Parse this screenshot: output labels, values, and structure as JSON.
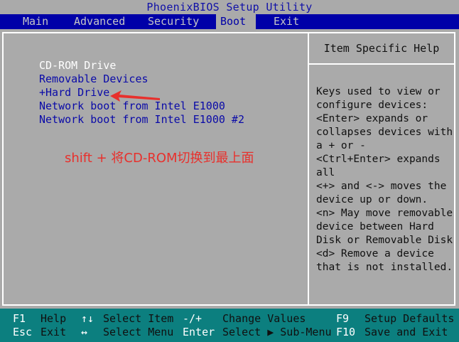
{
  "title": "PhoenixBIOS Setup Utility",
  "menu": [
    {
      "label": "Main",
      "active": false
    },
    {
      "label": "Advanced",
      "active": false
    },
    {
      "label": "Security",
      "active": false
    },
    {
      "label": "Boot",
      "active": true
    },
    {
      "label": "Exit",
      "active": false
    }
  ],
  "boot_order": [
    {
      "label": "CD-ROM Drive",
      "selected": true
    },
    {
      "label": "Removable Devices",
      "selected": false
    },
    {
      "label": "+Hard Drive",
      "selected": false
    },
    {
      "label": "Network boot from Intel E1000",
      "selected": false
    },
    {
      "label": "Network boot from Intel E1000 #2",
      "selected": false
    }
  ],
  "annotation": "shift + 将CD-ROM切换到最上面",
  "help": {
    "title": "Item Specific Help",
    "text": "Keys used to view or\nconfigure devices:\n<Enter> expands or\ncollapses devices with\na + or -\n<Ctrl+Enter> expands\nall\n<+> and <-> moves the\ndevice up or down.\n<n> May move removable\ndevice between Hard\nDisk or Removable Disk\n<d> Remove a device\nthat is not installed."
  },
  "footer": {
    "row1": {
      "k1": "F1",
      "d1": "Help",
      "k2": "↑↓",
      "d2": "Select Item",
      "k3": "-/+",
      "d3": "Change Values",
      "k4": "F9",
      "d4": "Setup Defaults"
    },
    "row2": {
      "k1": "Esc",
      "d1": "Exit",
      "k2": "↔",
      "d2": "Select Menu",
      "k3": "Enter",
      "d3": "Select ▶ Sub-Menu",
      "k4": "F10",
      "d4": "Save and Exit"
    }
  },
  "colors": {
    "menubar": "#0000a8",
    "panel": "#aaaaaa",
    "footer": "#0c7f7f",
    "annotation": "#e8302c"
  },
  "icons": {
    "arrow": "arrow-left-icon"
  }
}
